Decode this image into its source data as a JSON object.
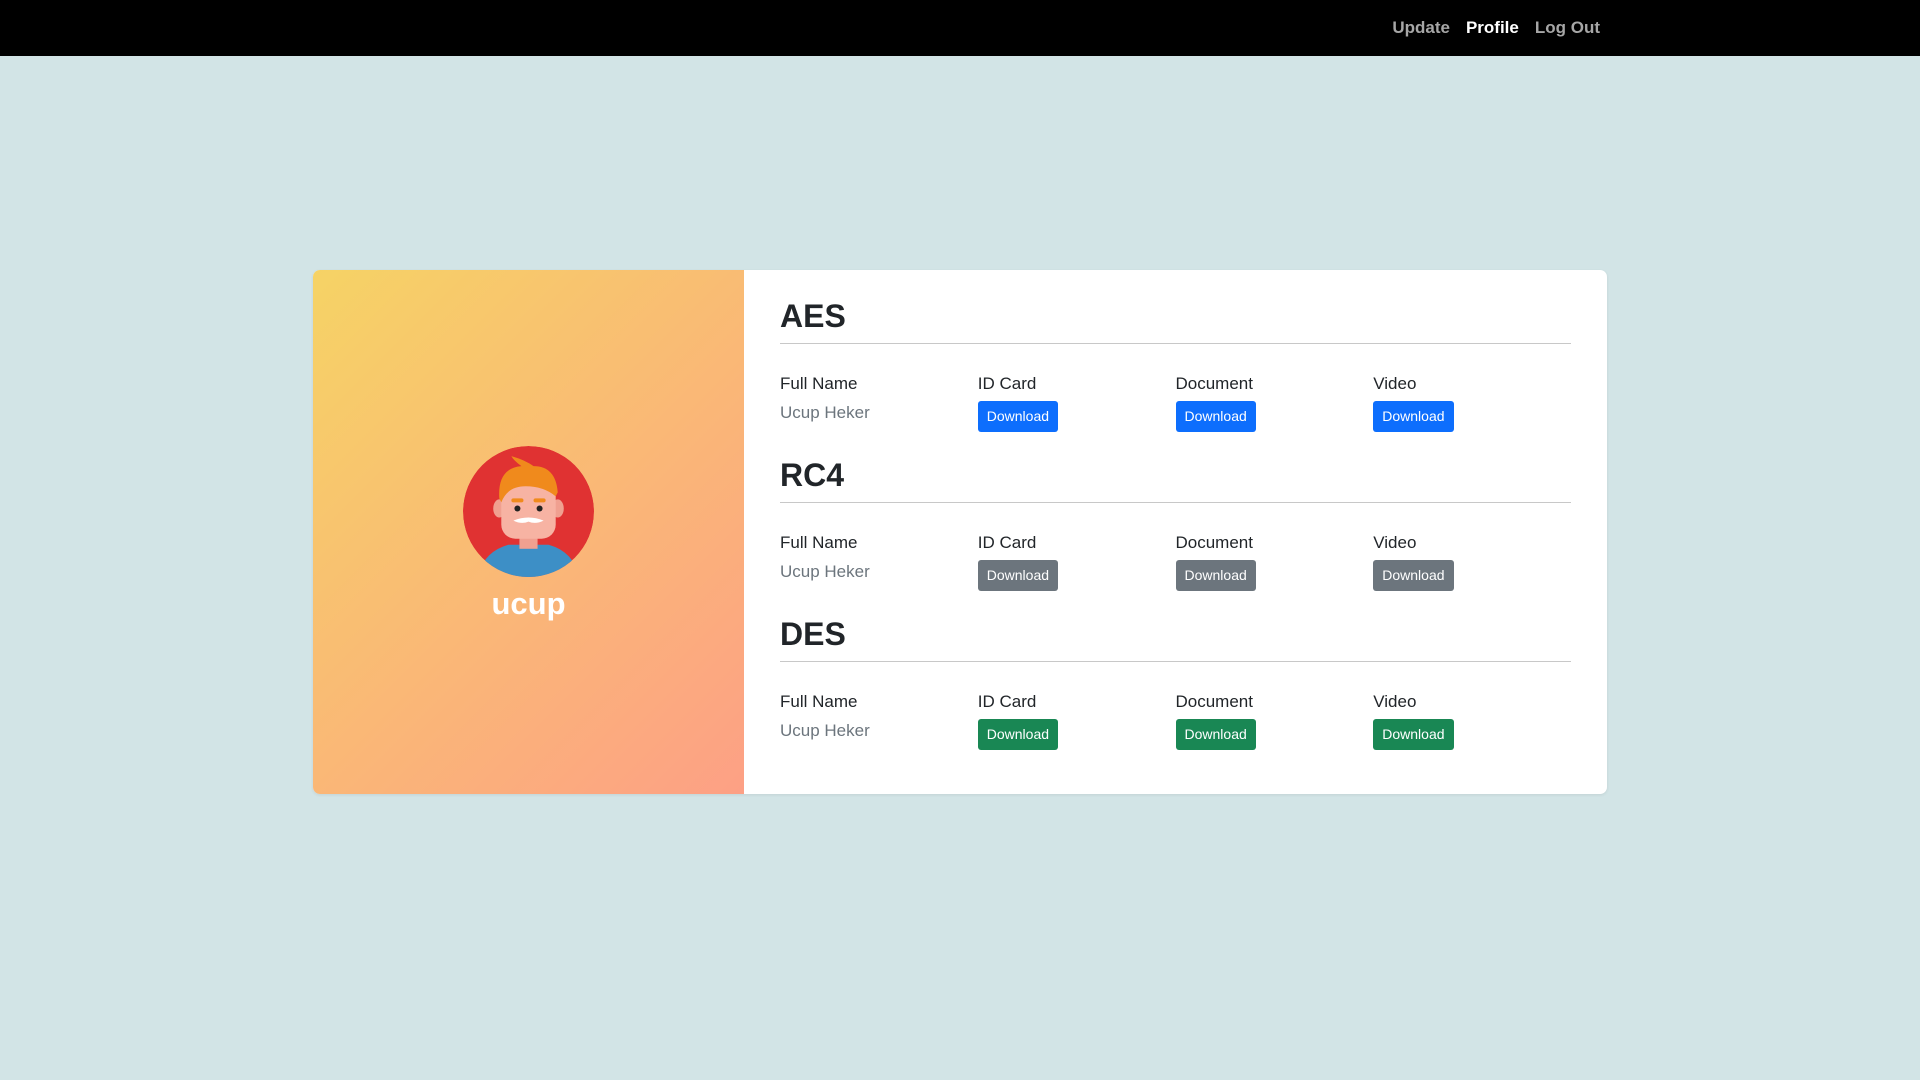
{
  "nav": {
    "items": [
      {
        "label": "Update",
        "active": false
      },
      {
        "label": "Profile",
        "active": true
      },
      {
        "label": "Log Out",
        "active": false
      }
    ]
  },
  "profile": {
    "username": "ucup",
    "avatar_icon": "man-avatar-icon",
    "gradient": [
      "#f6d365",
      "#fda085"
    ]
  },
  "sections": [
    {
      "title": "AES",
      "button_color": "#0d6efd",
      "full_name_label": "Full Name",
      "full_name_value": "Ucup Heker",
      "id_card_label": "ID Card",
      "document_label": "Document",
      "video_label": "Video",
      "download_label": "Download"
    },
    {
      "title": "RC4",
      "button_color": "#6c757d",
      "full_name_label": "Full Name",
      "full_name_value": "Ucup Heker",
      "id_card_label": "ID Card",
      "document_label": "Document",
      "video_label": "Video",
      "download_label": "Download"
    },
    {
      "title": "DES",
      "button_color": "#198754",
      "full_name_label": "Full Name",
      "full_name_value": "Ucup Heker",
      "id_card_label": "ID Card",
      "document_label": "Document",
      "video_label": "Video",
      "download_label": "Download"
    }
  ]
}
